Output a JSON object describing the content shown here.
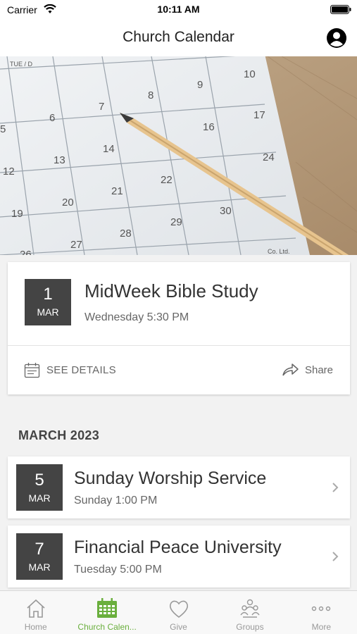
{
  "status_bar": {
    "carrier": "Carrier",
    "time": "10:11 AM"
  },
  "header": {
    "title": "Church Calendar"
  },
  "hero": {
    "calendar_header": "TUE / D",
    "calendar_numbers": [
      "10",
      "9",
      "8",
      "7",
      "6",
      "5",
      "17",
      "16",
      "13",
      "12",
      "14",
      "24",
      "22",
      "21",
      "20",
      "19",
      "30",
      "29",
      "28",
      "27",
      "26"
    ],
    "imprint": "Co. Ltd."
  },
  "featured": {
    "day": "1",
    "month": "MAR",
    "title": "MidWeek Bible Study",
    "time": "Wednesday 5:30 PM",
    "details_label": "SEE DETAILS",
    "share_label": "Share"
  },
  "section": {
    "title": "MARCH 2023"
  },
  "events": [
    {
      "day": "5",
      "month": "MAR",
      "title": "Sunday Worship Service",
      "time": "Sunday 1:00 PM"
    },
    {
      "day": "7",
      "month": "MAR",
      "title": "Financial Peace University",
      "time": "Tuesday 5:00 PM"
    }
  ],
  "tabs": [
    {
      "label": "Home",
      "icon": "home-icon"
    },
    {
      "label": "Church Calen...",
      "icon": "calendar-icon"
    },
    {
      "label": "Give",
      "icon": "heart-icon"
    },
    {
      "label": "Groups",
      "icon": "groups-icon"
    },
    {
      "label": "More",
      "icon": "more-icon"
    }
  ],
  "colors": {
    "accent": "#6aaf3d",
    "date_box": "#444444",
    "background": "#f2f2f2"
  }
}
